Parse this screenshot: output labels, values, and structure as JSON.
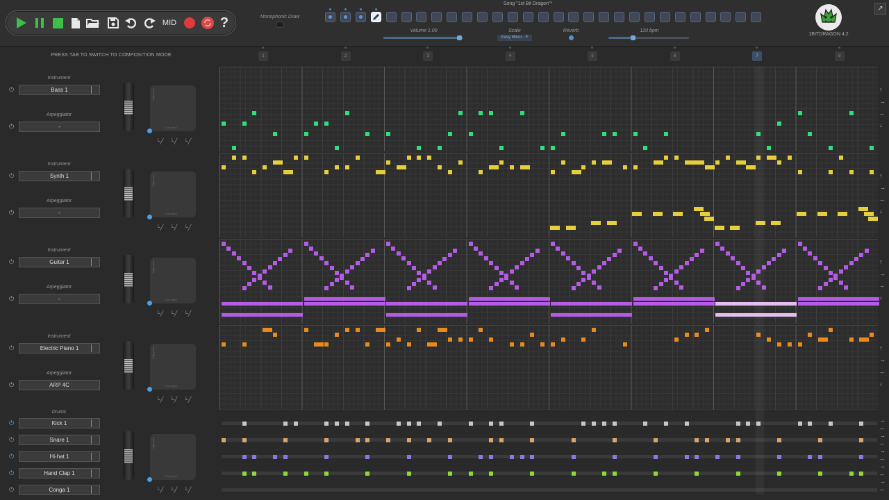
{
  "transport": {
    "mid_label": "MID",
    "help_label": "?",
    "colors": {
      "play": "#3dbf4a",
      "pause": "#3dbf4a",
      "stop": "#3dbf4a",
      "record": "#e03b3b",
      "loop": "#d94848"
    }
  },
  "header": {
    "song_title": "Song \"1st Bit Dragon\"*",
    "monophonic_label": "Monophonic Draw",
    "volume_label": "Volume 1.00",
    "volume_level": 0.95,
    "scale_label": "Scale",
    "scale_value": "Easy Minor - F",
    "reverb_label": "Reverb",
    "tempo_label": "120 bpm",
    "tempo_level": 0.3,
    "version": "1BITDRAGON 4.2",
    "pattern_slots": 29,
    "filled_slots": 3,
    "active_slot": 4
  },
  "hint": "PRESS TAB TO SWITCH TO COMPOSITION MODE",
  "bars": [
    "1",
    "2",
    "3",
    "4",
    "5",
    "6",
    "7",
    "8"
  ],
  "current_bar": 7,
  "tracks": [
    {
      "section_label": "Instrument",
      "name": "Bass 1",
      "arp_label": "Arpeggiator",
      "arp": "-",
      "color": "#2fe07a"
    },
    {
      "section_label": "Instrument",
      "name": "Synth 1",
      "arp_label": "Arpeggiator",
      "arp": "-",
      "color": "#e6cf3a"
    },
    {
      "section_label": "Instrument",
      "name": "Guitar 1",
      "arp_label": "Arpeggiator",
      "arp": "-",
      "color": "#b45ce6"
    },
    {
      "section_label": "Instrument",
      "name": "Electric Piano 1",
      "arp_label": "Arpeggiator",
      "arp": "ARP 4C",
      "color": "#e88a1e"
    }
  ],
  "xy_pad": {
    "high_label": "High pass",
    "low_label": "Low pass"
  },
  "drums": {
    "section_label": "Drums",
    "items": [
      {
        "name": "Kick 1",
        "color": "#c8c8c8"
      },
      {
        "name": "Snare 1",
        "color": "#d8a66a"
      },
      {
        "name": "Hi-hat 1",
        "color": "#8a7ae6"
      },
      {
        "name": "Hand Clap 1",
        "color": "#8fd83a"
      },
      {
        "name": "Conga 1",
        "color": "#9a9a9a"
      }
    ]
  }
}
